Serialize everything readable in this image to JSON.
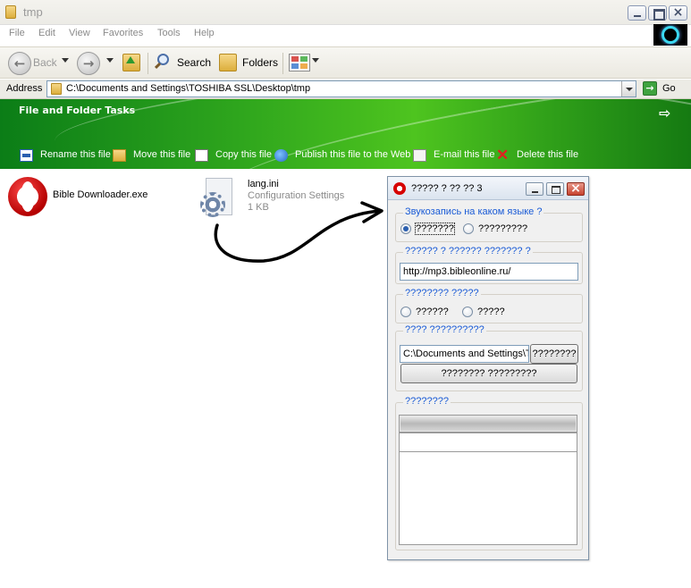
{
  "window": {
    "title": "tmp",
    "menu": [
      "File",
      "Edit",
      "View",
      "Favorites",
      "Tools",
      "Help"
    ]
  },
  "toolbar": {
    "back_label": "Back",
    "search_label": "Search",
    "folders_label": "Folders"
  },
  "address": {
    "label": "Address",
    "path": "C:\\Documents and Settings\\TOSHIBA SSL\\Desktop\\tmp",
    "go_label": "Go"
  },
  "tasks": {
    "title": "File and Folder Tasks",
    "items": [
      {
        "label": "Rename this file",
        "icon": "rename-icon"
      },
      {
        "label": "Move this file",
        "icon": "move-icon"
      },
      {
        "label": "Copy this file",
        "icon": "copy-icon"
      },
      {
        "label": "Publish this file to the Web",
        "icon": "publish-icon"
      },
      {
        "label": "E-mail this file",
        "icon": "email-icon"
      },
      {
        "label": "Delete this file",
        "icon": "delete-icon"
      }
    ]
  },
  "files": [
    {
      "name": "Bible Downloader.exe",
      "icon": "opera-icon"
    },
    {
      "name": "lang.ini",
      "type": "Configuration Settings",
      "size": "1 KB",
      "icon": "config-file-icon"
    }
  ],
  "dialog": {
    "title": "????? ? ?? ?? 3",
    "group1": {
      "label": "Звукозапись на каком языке ?",
      "option_a": "???????",
      "option_b": "?????????",
      "selected": "option_a"
    },
    "group2": {
      "label": "?????? ? ?????? ??????? ?",
      "url": "http://mp3.bibleonline.ru/"
    },
    "group3": {
      "label": "???????? ?????",
      "option_a": "??????",
      "option_b": "?????"
    },
    "group4": {
      "label": "???? ??????????",
      "path": "C:\\Documents and Settings\\TOSHIBA SSL\\",
      "browse_label": "????????",
      "start_label": "???????? ?????????"
    },
    "group5": {
      "label": "????????",
      "progress_fraction": 1.0
    }
  },
  "colors": {
    "task_banner": "#2fa61d",
    "group_label": "#1a5bd6"
  }
}
